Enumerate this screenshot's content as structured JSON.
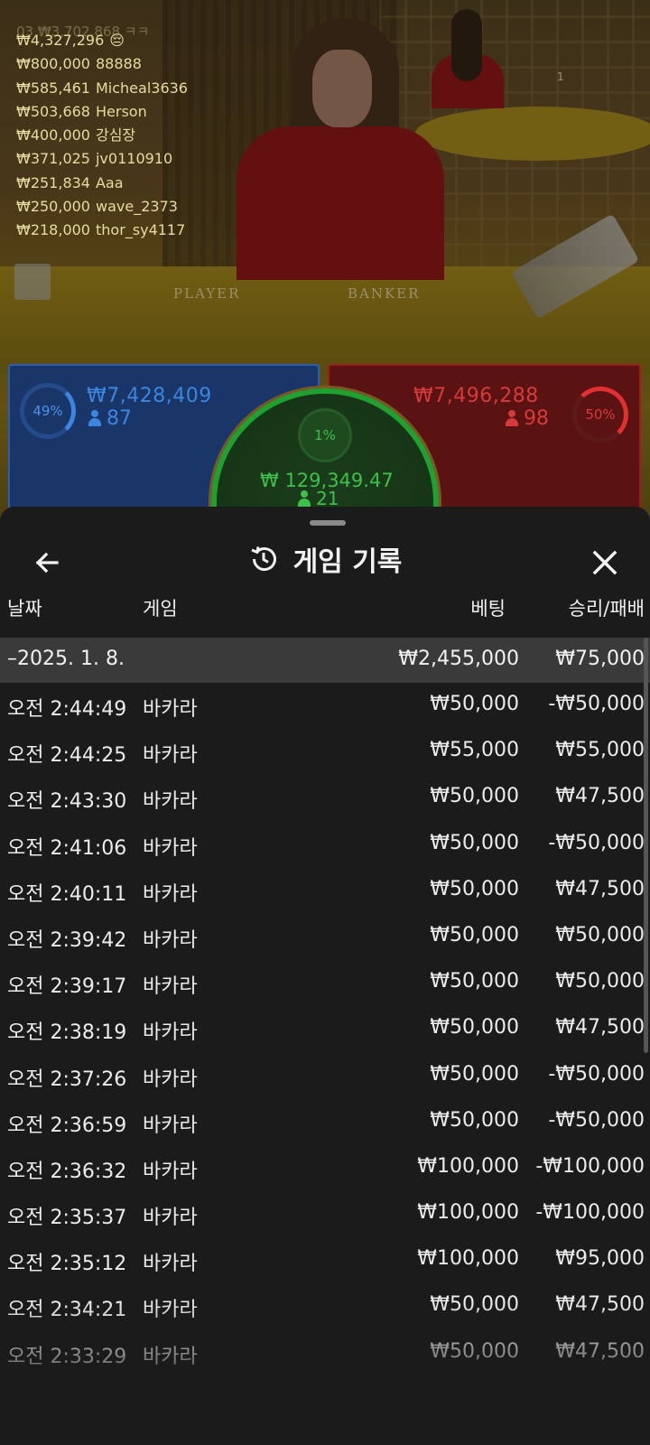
{
  "leaderboard": {
    "top_cut": "03 ₩3,702,868 ㅋㅋ",
    "entries": [
      {
        "amount": "₩4,327,296",
        "name": "😔"
      },
      {
        "amount": "₩800,000",
        "name": "88888"
      },
      {
        "amount": "₩585,461",
        "name": "Micheal3636"
      },
      {
        "amount": "₩503,668",
        "name": "Herson"
      },
      {
        "amount": "₩400,000",
        "name": "강심장"
      },
      {
        "amount": "₩371,025",
        "name": "jv0110910"
      },
      {
        "amount": "₩251,834",
        "name": "Aaa"
      },
      {
        "amount": "₩250,000",
        "name": "wave_2373"
      },
      {
        "amount": "₩218,000",
        "name": "thor_sy4117"
      }
    ]
  },
  "table": {
    "player_label": "PLAYER",
    "banker_label": "BANKER",
    "marker": "1"
  },
  "bets": {
    "player": {
      "percent": "49%",
      "amount": "₩7,428,409",
      "count": "87",
      "color": "#3a86e0"
    },
    "banker": {
      "percent": "50%",
      "amount": "₩7,496,288",
      "count": "98",
      "color": "#d63a3a"
    },
    "tie": {
      "percent": "1%",
      "amount": "₩ 129,349.47",
      "count": "21",
      "color": "#3cc04a"
    }
  },
  "sheet": {
    "title": "게임 기록",
    "icons": {
      "back": "arrow-left-icon",
      "history": "history-icon",
      "close": "close-icon"
    },
    "columns": {
      "date": "날짜",
      "game": "게임",
      "bet": "베팅",
      "result": "승리/패배"
    },
    "group": {
      "date": "–2025. 1. 8.",
      "bet_total": "₩2,455,000",
      "result_total": "₩75,000"
    },
    "rows": [
      {
        "time": "오전 2:44:49",
        "game": "바카라",
        "bet": "₩50,000",
        "result": "-₩50,000"
      },
      {
        "time": "오전 2:44:25",
        "game": "바카라",
        "bet": "₩55,000",
        "result": "₩55,000"
      },
      {
        "time": "오전 2:43:30",
        "game": "바카라",
        "bet": "₩50,000",
        "result": "₩47,500"
      },
      {
        "time": "오전 2:41:06",
        "game": "바카라",
        "bet": "₩50,000",
        "result": "-₩50,000"
      },
      {
        "time": "오전 2:40:11",
        "game": "바카라",
        "bet": "₩50,000",
        "result": "₩47,500"
      },
      {
        "time": "오전 2:39:42",
        "game": "바카라",
        "bet": "₩50,000",
        "result": "₩50,000"
      },
      {
        "time": "오전 2:39:17",
        "game": "바카라",
        "bet": "₩50,000",
        "result": "₩50,000"
      },
      {
        "time": "오전 2:38:19",
        "game": "바카라",
        "bet": "₩50,000",
        "result": "₩47,500"
      },
      {
        "time": "오전 2:37:26",
        "game": "바카라",
        "bet": "₩50,000",
        "result": "-₩50,000"
      },
      {
        "time": "오전 2:36:59",
        "game": "바카라",
        "bet": "₩50,000",
        "result": "-₩50,000"
      },
      {
        "time": "오전 2:36:32",
        "game": "바카라",
        "bet": "₩100,000",
        "result": "-₩100,000"
      },
      {
        "time": "오전 2:35:37",
        "game": "바카라",
        "bet": "₩100,000",
        "result": "-₩100,000"
      },
      {
        "time": "오전 2:35:12",
        "game": "바카라",
        "bet": "₩100,000",
        "result": "₩95,000"
      },
      {
        "time": "오전 2:34:21",
        "game": "바카라",
        "bet": "₩50,000",
        "result": "₩47,500"
      },
      {
        "time": "오전 2:33:29",
        "game": "바카라",
        "bet": "₩50,000",
        "result": "₩47,500"
      }
    ]
  }
}
